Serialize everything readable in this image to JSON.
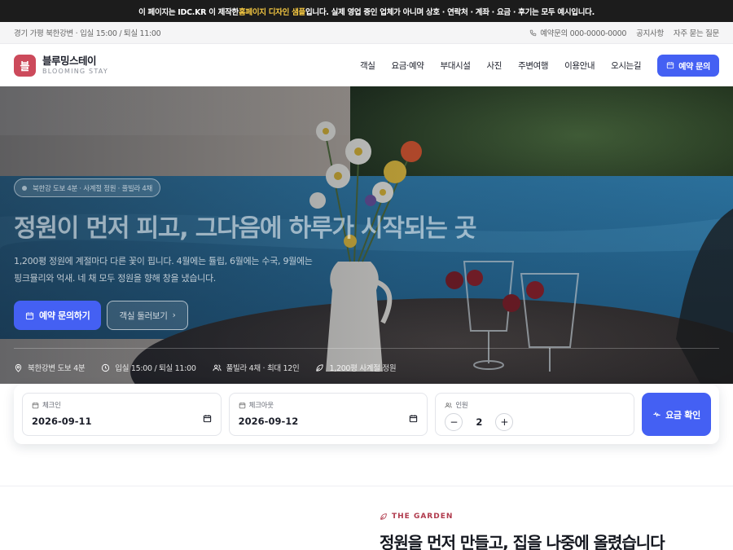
{
  "notice": {
    "part1": "이 페이지는 IDC.KR 이 제작한 ",
    "highlight": "홈페이지 디자인 샘플",
    "part2": "입니다. 실제 영업 중인 업체가 아니며 상호 · 연락처 · 계좌 · 요금 · 후기는 모두 예시입니다."
  },
  "utility": {
    "info": "경기 가평 북한강변 · 입실 15:00 / 퇴실 11:00",
    "phone": "예약문의 000-0000-0000",
    "links": [
      "공지사항",
      "자주 묻는 질문"
    ]
  },
  "brand": {
    "mark": "블",
    "name": "블루밍스테이",
    "sub": "BLOOMING STAY"
  },
  "nav": {
    "items": [
      "객실",
      "요금·예약",
      "부대시설",
      "사진",
      "주변여행",
      "이용안내",
      "오시는길"
    ],
    "cta": "예약 문의"
  },
  "hero": {
    "chip": "북한강 도보 4분 · 사계절 정원 · 풀빌라 4채",
    "title": "정원이 먼저 피고, 그다음에 하루가 시작되는 곳",
    "desc1": "1,200평 정원에 계절마다 다른 꽃이 핍니다. 4월에는 튤립, 6월에는 수국, 9월에는",
    "desc2": "핑크뮬리와 억새. 네 채 모두 정원을 향해 창을 냈습니다.",
    "primary_btn": "예약 문의하기",
    "ghost_btn": "객실 둘러보기",
    "facts": [
      "북한강변 도보 4분",
      "입실 15:00 / 퇴실 11:00",
      "풀빌라 4채 · 최대 12인",
      "1,200평 사계절 정원"
    ]
  },
  "booking": {
    "checkin_label": "체크인",
    "checkin_value": "2026-09-11",
    "checkout_label": "체크아웃",
    "checkout_value": "2026-09-12",
    "guests_label": "인원",
    "guests_value": "2",
    "minus": "−",
    "plus": "+",
    "submit": "요금 확인"
  },
  "garden": {
    "tag": "THE GARDEN",
    "title": "정원을 먼저 만들고, 집을 나중에 올렸습니다"
  },
  "colors": {
    "accent": "#4460f3",
    "brand": "#cc4a5b",
    "notice_bg": "#1c1c1c",
    "highlight": "#f5c842"
  }
}
